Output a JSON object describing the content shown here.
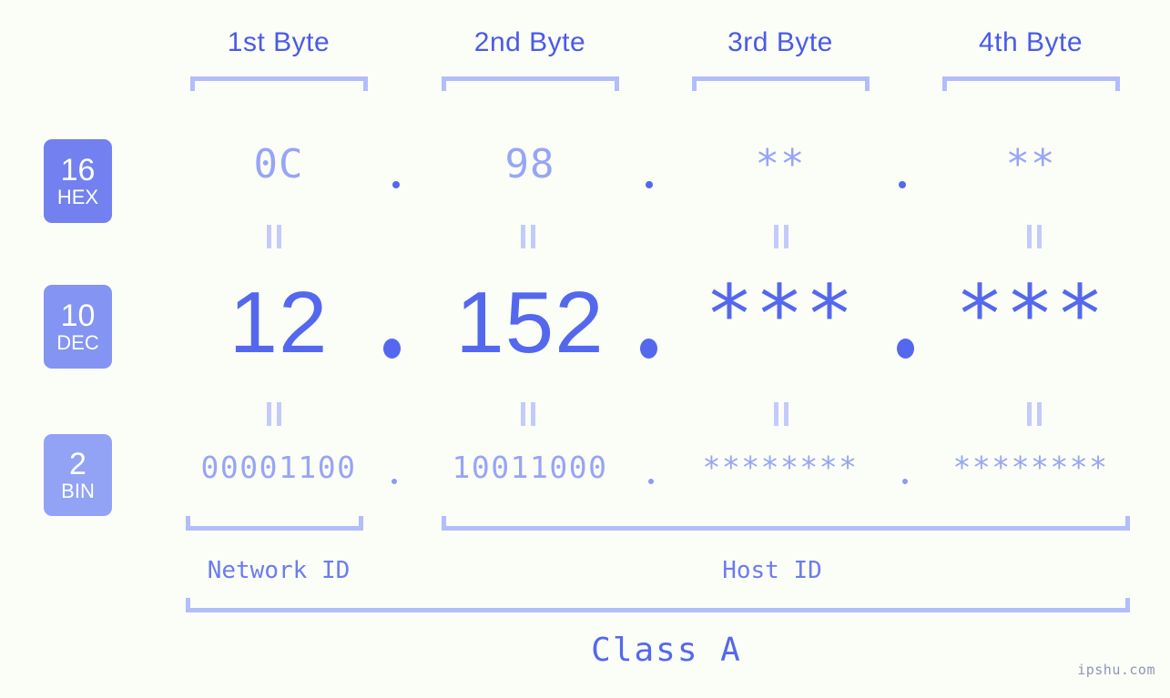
{
  "background_color": "#fbfdf7",
  "accent_colors": {
    "strong": "#5468ee",
    "light": "#97a5f5",
    "bracket": "#b2bdfb",
    "eqbar": "#c3cbfb",
    "watermark": "#8e97b5"
  },
  "byte_headers": [
    {
      "label": "1st Byte"
    },
    {
      "label": "2nd Byte"
    },
    {
      "label": "3rd Byte"
    },
    {
      "label": "4th Byte"
    }
  ],
  "radix_badges": [
    {
      "number": "16",
      "name": "HEX",
      "color": "#7281ef"
    },
    {
      "number": "10",
      "name": "DEC",
      "color": "#8494f2"
    },
    {
      "number": "2",
      "name": "BIN",
      "color": "#92a3f6"
    }
  ],
  "rows": {
    "hex": {
      "values": [
        "0C",
        "98",
        "**",
        "**"
      ],
      "separator": "."
    },
    "dec": {
      "values": [
        "12",
        "152",
        "***",
        "***"
      ],
      "separator": "."
    },
    "bin": {
      "values": [
        "00001100",
        "10011000",
        "********",
        "********"
      ],
      "separator": "."
    }
  },
  "equals_marks": {
    "symbol": "||",
    "count_per_gap": 4
  },
  "id_sections": [
    {
      "label": "Network ID"
    },
    {
      "label": "Host ID"
    }
  ],
  "class_label": "Class A",
  "watermark": "ipshu.com"
}
